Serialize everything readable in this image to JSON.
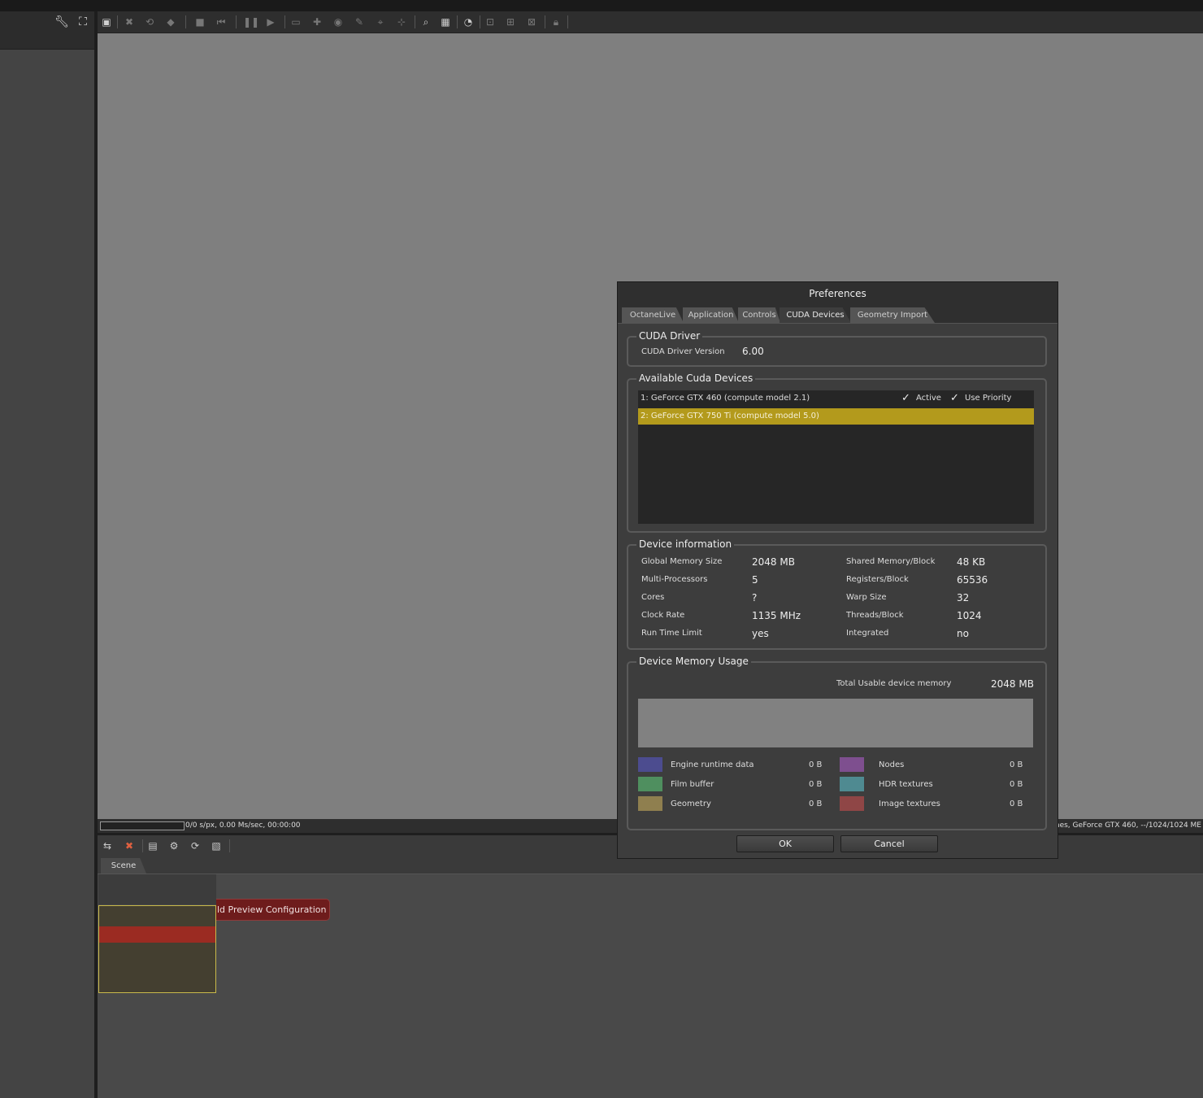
{
  "status_bar": {
    "left": "0/0 s/px, 0.00 Ms/sec, 00:00:00",
    "right": "Meshes, GeForce GTX 460, --/1024/1024 ME"
  },
  "scene_tab": "Scene",
  "node_graph": {
    "node_label": "ld Preview Configuration"
  },
  "dialog": {
    "title": "Preferences",
    "tabs": [
      "OctaneLive",
      "Application",
      "Controls",
      "CUDA Devices",
      "Geometry Import"
    ],
    "selected_tab": "CUDA Devices",
    "cuda_driver": {
      "group_title": "CUDA Driver",
      "version_label": "CUDA Driver Version",
      "version_value": "6.00"
    },
    "devices": {
      "group_title": "Available Cuda Devices",
      "items": [
        {
          "name": "1: GeForce GTX 460 (compute model 2.1)",
          "active_label": "Active",
          "active": true,
          "priority_label": "Use Priority",
          "priority": true
        },
        {
          "name": "2: GeForce GTX 750 Ti (compute model 5.0)"
        }
      ]
    },
    "device_info": {
      "group_title": "Device information",
      "left": [
        {
          "label": "Global Memory Size",
          "value": "2048 MB"
        },
        {
          "label": "Multi-Processors",
          "value": "5"
        },
        {
          "label": "Cores",
          "value": "?"
        },
        {
          "label": "Clock Rate",
          "value": "1135 MHz"
        },
        {
          "label": "Run Time Limit",
          "value": "yes"
        }
      ],
      "right": [
        {
          "label": "Shared Memory/Block",
          "value": "48 KB"
        },
        {
          "label": "Registers/Block",
          "value": "65536"
        },
        {
          "label": "Warp Size",
          "value": "32"
        },
        {
          "label": "Threads/Block",
          "value": "1024"
        },
        {
          "label": "Integrated",
          "value": "no"
        }
      ]
    },
    "memory": {
      "group_title": "Device Memory Usage",
      "total_label": "Total Usable device memory",
      "total_value": "2048 MB",
      "legend": [
        {
          "label": "Engine runtime data",
          "value": "0 B",
          "color": "#4c4c8f"
        },
        {
          "label": "Nodes",
          "value": "0 B",
          "color": "#7e4f8f"
        },
        {
          "label": "Film buffer",
          "value": "0 B",
          "color": "#4f8f5f"
        },
        {
          "label": "HDR textures",
          "value": "0 B",
          "color": "#4f8a91"
        },
        {
          "label": "Geometry",
          "value": "0 B",
          "color": "#8f7f4f"
        },
        {
          "label": "Image textures",
          "value": "0 B",
          "color": "#8f4646"
        }
      ]
    },
    "ok_label": "OK",
    "cancel_label": "Cancel"
  }
}
